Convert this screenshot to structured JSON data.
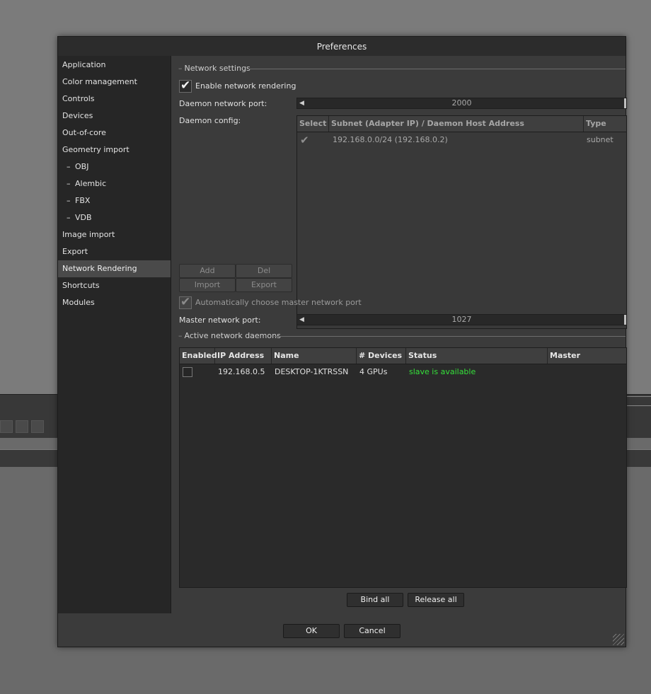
{
  "dialog": {
    "title": "Preferences"
  },
  "sidebar": {
    "items": [
      {
        "label": "Application"
      },
      {
        "label": "Color management"
      },
      {
        "label": "Controls"
      },
      {
        "label": "Devices"
      },
      {
        "label": "Out-of-core"
      },
      {
        "label": "Geometry import"
      },
      {
        "label": "OBJ",
        "prefix": "–"
      },
      {
        "label": "Alembic",
        "prefix": "–"
      },
      {
        "label": "FBX",
        "prefix": "–"
      },
      {
        "label": "VDB",
        "prefix": "–"
      },
      {
        "label": "Image import"
      },
      {
        "label": "Export"
      },
      {
        "label": "Network Rendering",
        "selected": true
      },
      {
        "label": "Shortcuts"
      },
      {
        "label": "Modules"
      }
    ]
  },
  "network_settings": {
    "group_title": "Network settings",
    "enable_label": "Enable network rendering",
    "enable_checked": true,
    "daemon_port_label": "Daemon network port:",
    "daemon_port_value": "2000",
    "daemon_config_label": "Daemon config:",
    "config_table": {
      "headers": [
        "Select",
        "Subnet (Adapter IP) / Daemon Host Address",
        "Type"
      ],
      "rows": [
        {
          "select": true,
          "address": "192.168.0.0/24 (192.168.0.2)",
          "type": "subnet"
        }
      ]
    },
    "buttons": {
      "add": "Add",
      "del": "Del",
      "import": "Import",
      "export": "Export"
    },
    "auto_master_label": "Automatically choose master network port",
    "auto_master_checked": true,
    "master_port_label": "Master network port:",
    "master_port_value": "1027"
  },
  "active_daemons": {
    "group_title": "Active network daemons",
    "headers": [
      "Enabled",
      "IP Address",
      "Name",
      "# Devices",
      "Status",
      "Master"
    ],
    "rows": [
      {
        "enabled": false,
        "ip": "192.168.0.5",
        "name": "DESKTOP-1KTRSSN",
        "devices": "4 GPUs",
        "status": "slave is available",
        "master": ""
      }
    ],
    "bind_all": "Bind all",
    "release_all": "Release all"
  },
  "footer": {
    "ok": "OK",
    "cancel": "Cancel"
  },
  "colors": {
    "status_available": "#35e03a",
    "panel": "#3b3b3b",
    "sidebar": "#262626"
  }
}
